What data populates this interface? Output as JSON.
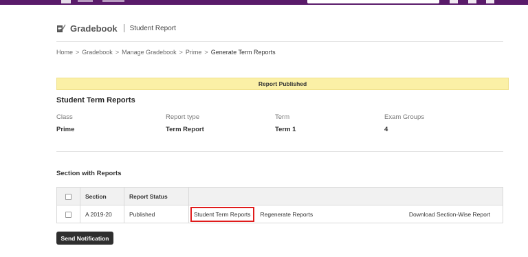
{
  "header": {
    "title": "Gradebook",
    "subtitle": "Student Report",
    "icon": "gradebook-icon"
  },
  "breadcrumb": [
    {
      "label": "Home"
    },
    {
      "label": "Gradebook"
    },
    {
      "label": "Manage Gradebook"
    },
    {
      "label": "Prime"
    },
    {
      "label": "Generate Term Reports"
    }
  ],
  "banner": {
    "text": "Report Published",
    "color": "#fbf0a6"
  },
  "report": {
    "title": "Student Term Reports",
    "class_label": "Class",
    "class_value": "Prime",
    "type_label": "Report type",
    "type_value": "Term Report",
    "term_label": "Term",
    "term_value": "Term 1",
    "exam_label": "Exam Groups",
    "exam_value": "4"
  },
  "sections": {
    "title": "Section with Reports",
    "columns": [
      "Section",
      "Report Status"
    ],
    "rows": [
      {
        "section": "A 2019-20",
        "status": "Published",
        "actions": {
          "view": "Student Term Reports",
          "regenerate": "Regenerate Reports",
          "download": "Download Section-Wise Report"
        }
      }
    ]
  },
  "buttons": {
    "send_notification": "Send Notification"
  },
  "colors": {
    "topbar": "#5a1b6a",
    "highlight": "#e01b1b"
  }
}
